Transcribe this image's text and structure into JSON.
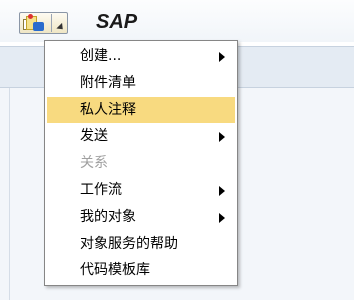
{
  "app": {
    "title": "SAP"
  },
  "gos_button": {
    "icon": "services-for-object-icon",
    "dropdown_icon": "dropdown-arrow-icon"
  },
  "menu": {
    "items": [
      {
        "label": "创建...",
        "has_submenu": true,
        "state": "normal"
      },
      {
        "label": "附件清单",
        "has_submenu": false,
        "state": "normal"
      },
      {
        "label": "私人注释",
        "has_submenu": false,
        "state": "selected"
      },
      {
        "label": "发送",
        "has_submenu": true,
        "state": "normal"
      },
      {
        "label": "关系",
        "has_submenu": false,
        "state": "disabled"
      },
      {
        "label": "工作流",
        "has_submenu": true,
        "state": "normal"
      },
      {
        "label": "我的对象",
        "has_submenu": true,
        "state": "normal"
      },
      {
        "label": "对象服务的帮助",
        "has_submenu": false,
        "state": "normal"
      },
      {
        "label": "代码模板库",
        "has_submenu": false,
        "state": "normal"
      }
    ]
  },
  "colors": {
    "selected_background": "#f8da80",
    "disabled_text": "#a0a0a0",
    "toolbar_background": "#e4ebf3"
  }
}
